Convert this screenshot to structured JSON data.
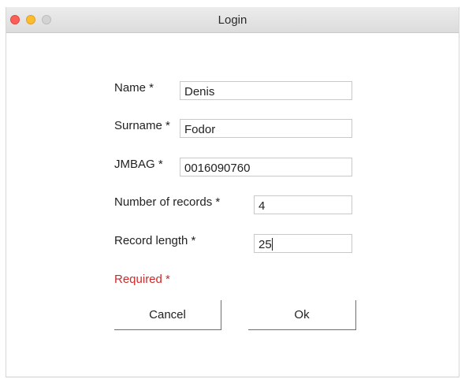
{
  "window": {
    "title": "Login",
    "controls": [
      "close",
      "minimize",
      "zoom"
    ]
  },
  "form": {
    "fields": [
      {
        "label": "Name *",
        "value": "Denis"
      },
      {
        "label": "Surname *",
        "value": "Fodor"
      },
      {
        "label": "JMBAG *",
        "value": "0016090760"
      },
      {
        "label": "Number of records *",
        "value": "4"
      },
      {
        "label": "Record length *",
        "value": "25"
      }
    ],
    "required_note": "Required *"
  },
  "buttons": {
    "cancel_label": "Cancel",
    "ok_label": "Ok"
  },
  "colors": {
    "required_text": "#cc2a2a",
    "close": "#fc5f57",
    "minimize": "#fdbc2e",
    "zoom": "#d3d3d3"
  }
}
